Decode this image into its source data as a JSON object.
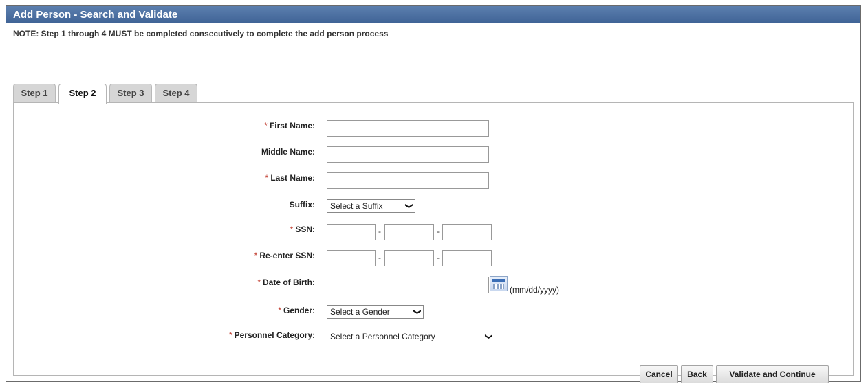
{
  "window": {
    "title": "Add Person - Search and Validate"
  },
  "note": "NOTE: Step 1 through 4 MUST be completed consecutively to complete the add person process",
  "tabs": [
    {
      "label": "Step 1",
      "active": false
    },
    {
      "label": "Step 2",
      "active": true
    },
    {
      "label": "Step 3",
      "active": false
    },
    {
      "label": "Step 4",
      "active": false
    }
  ],
  "form": {
    "required_marker": "*",
    "first_name": {
      "label": "First Name:",
      "value": ""
    },
    "middle_name": {
      "label": "Middle Name:",
      "value": ""
    },
    "last_name": {
      "label": "Last Name:",
      "value": ""
    },
    "suffix": {
      "label": "Suffix:",
      "selected": "Select a Suffix"
    },
    "ssn": {
      "label": "SSN:",
      "separator": "-",
      "parts": [
        "",
        "",
        ""
      ]
    },
    "ssn_reenter": {
      "label": "Re-enter SSN:",
      "separator": "-",
      "parts": [
        "",
        "",
        ""
      ]
    },
    "dob": {
      "label": "Date of Birth:",
      "value": "",
      "format_hint": "(mm/dd/yyyy)",
      "icon": "calendar-icon"
    },
    "gender": {
      "label": "Gender:",
      "selected": "Select a Gender"
    },
    "personnel_category": {
      "label": "Personnel Category:",
      "selected": "Select a Personnel Category"
    }
  },
  "buttons": {
    "cancel": "Cancel",
    "back": "Back",
    "validate": "Validate and Continue"
  },
  "colors": {
    "titlebar": "#4a6fa5",
    "required": "#c0392b"
  }
}
